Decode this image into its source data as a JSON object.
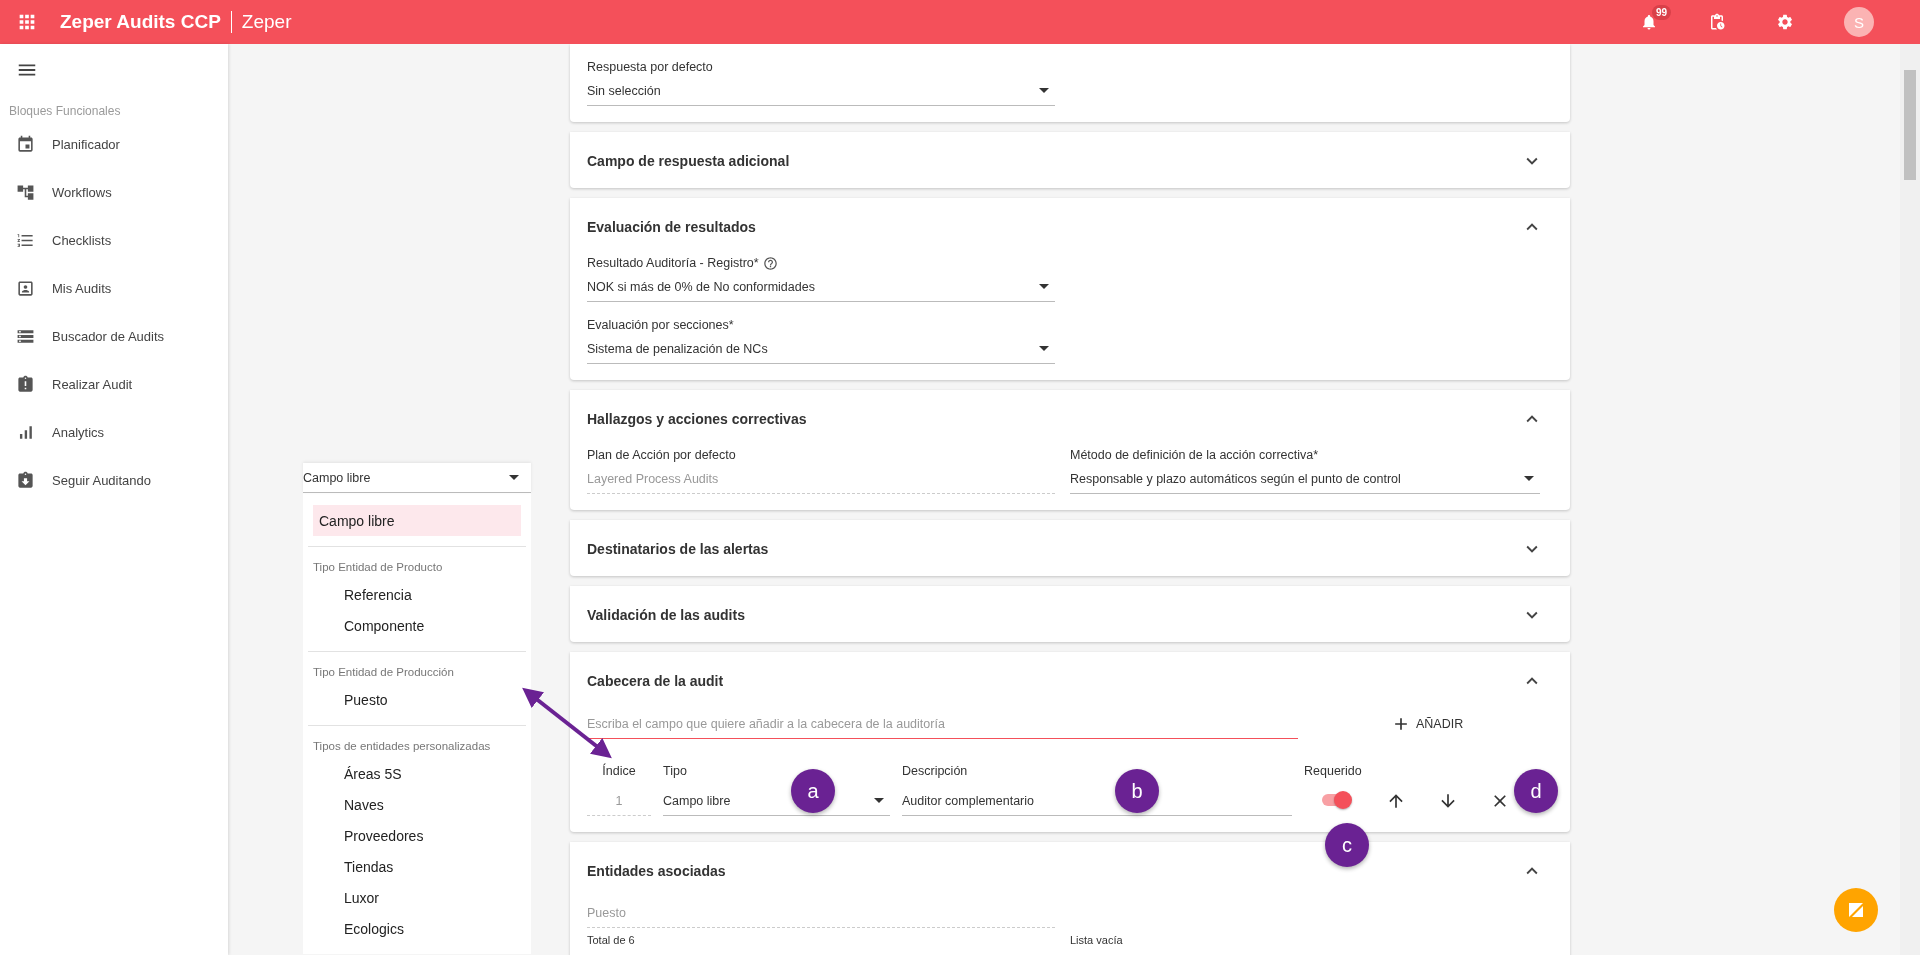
{
  "app_bar": {
    "title": "Zeper Audits CCP",
    "subtitle": "Zeper",
    "notification_count": "99",
    "avatar_initial": "S"
  },
  "sidebar": {
    "section_title": "Bloques Funcionales",
    "items": [
      {
        "label": "Planificador",
        "selected": false
      },
      {
        "label": "Workflows",
        "selected": false
      },
      {
        "label": "Checklists",
        "selected": false
      },
      {
        "label": "Mis Audits",
        "selected": false
      },
      {
        "label": "Buscador de Audits",
        "selected": false
      },
      {
        "label": "Realizar Audit",
        "selected": false
      },
      {
        "label": "Analytics",
        "selected": false
      },
      {
        "label": "Seguir Auditando",
        "selected": false
      }
    ]
  },
  "sections": [
    {
      "kind": "fields",
      "rows": [
        [
          {
            "kind": "select",
            "label": "Respuesta por defecto",
            "value": "Sin selección"
          }
        ]
      ]
    },
    {
      "title": "Campo de respuesta adicional",
      "expanded": false
    },
    {
      "kind": "fields",
      "title": "Evaluación de resultados",
      "expanded": true,
      "rows": [
        [
          {
            "kind": "select",
            "label": "Resultado Auditoría - Registro*",
            "value": "NOK si más de 0% de No conformidades",
            "help": true
          }
        ],
        [
          {
            "kind": "select",
            "label": "Evaluación por secciones*",
            "value": "Sistema de penalización de NCs"
          }
        ]
      ]
    },
    {
      "kind": "fields",
      "title": "Hallazgos y acciones correctivas",
      "expanded": true,
      "rows": [
        [
          {
            "kind": "readonly",
            "label": "Plan de Acción por defecto",
            "value": "Layered Process Audits"
          },
          {
            "kind": "select",
            "label": "Método de definición de la acción correctiva*",
            "value": "Responsable y plazo automáticos según el punto de control"
          }
        ]
      ]
    },
    {
      "title": "Destinatarios de las alertas",
      "expanded": false
    },
    {
      "title": "Validación de las audits",
      "expanded": false
    },
    {
      "kind": "table",
      "title": "Cabecera de la audit",
      "expanded": true,
      "search_placeholder": "Escriba el campo que quiere añadir a la cabecera de la auditoría",
      "add_button": "AÑADIR",
      "columns": [
        "Índice",
        "Tipo",
        "Descripción",
        "Requerido"
      ],
      "rows": [
        {
          "index": "1",
          "type": "Campo libre",
          "description": "Auditor complementario",
          "required": true
        }
      ]
    },
    {
      "kind": "entities",
      "title": "Entidades asociadas",
      "expanded": true,
      "field_placeholder": "Puesto",
      "column_1": "Total de 6",
      "column_2": "Lista vacía"
    }
  ],
  "type_dropdown": {
    "value": "Campo libre",
    "groups": [
      {
        "options": [
          {
            "label": "Campo libre",
            "selected": true
          }
        ]
      },
      {
        "title": "Tipo Entidad de Producto",
        "options": [
          {
            "label": "Referencia",
            "selected": false
          },
          {
            "label": "Componente",
            "selected": false
          }
        ]
      },
      {
        "title": "Tipo Entidad de Producción",
        "options": [
          {
            "label": "Puesto",
            "selected": false
          }
        ]
      },
      {
        "title": "Tipos de entidades personalizadas",
        "options": [
          {
            "label": "Áreas 5S",
            "selected": false
          },
          {
            "label": "Naves",
            "selected": false
          },
          {
            "label": "Proveedores",
            "selected": false
          },
          {
            "label": "Tiendas",
            "selected": false
          },
          {
            "label": "Luxor",
            "selected": false
          },
          {
            "label": "Ecologics",
            "selected": false
          }
        ]
      }
    ]
  },
  "callouts": [
    "a",
    "b",
    "c",
    "d"
  ]
}
